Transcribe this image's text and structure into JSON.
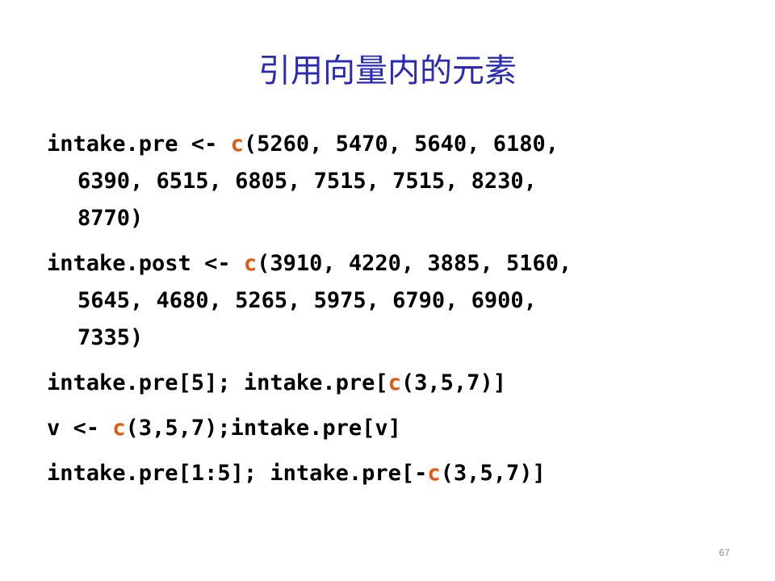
{
  "slide": {
    "title": "引用向量内的元素",
    "page_number": "67"
  },
  "code": {
    "block1": {
      "line1_pre": "intake.pre <- ",
      "fn": "c",
      "line1_post": "(5260, 5470, 5640, 6180,",
      "line2": "6390, 6515, 6805, 7515, 7515, 8230,",
      "line3": "8770)"
    },
    "block2": {
      "line1_pre": "intake.post <- ",
      "fn": "c",
      "line1_post": "(3910, 4220, 3885, 5160,",
      "line2": "5645, 4680, 5265, 5975, 6790, 6900,",
      "line3": "7335)"
    },
    "block3": {
      "pre": "intake.pre[5]; intake.pre[",
      "fn": "c",
      "post": "(3,5,7)]"
    },
    "block4": {
      "pre": "v <- ",
      "fn": "c",
      "post": "(3,5,7);intake.pre[v]"
    },
    "block5": {
      "pre": "intake.pre[1:5]; intake.pre[-",
      "fn": "c",
      "post": "(3,5,7)]"
    }
  },
  "colors": {
    "title": "#2a2ab8",
    "function_highlight": "#e05a10",
    "code_text": "#000000",
    "page_number": "#8c8c8c"
  }
}
